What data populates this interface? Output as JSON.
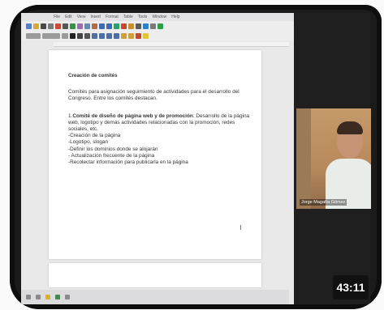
{
  "menu": {
    "items": [
      "File",
      "Edit",
      "View",
      "Insert",
      "Format",
      "Table",
      "Tools",
      "Window",
      "Help"
    ]
  },
  "document": {
    "title": "Creación de comités",
    "intro": "Comités para asignación seguimiento de actividades para el desarrollo del Congreso. Entre los comités destacan.",
    "committee_lead_number": "1.",
    "committee_lead_bold": "Comité de diseño de página web y de promoción",
    "committee_lead_rest": ": Desarrollo de la página web, logotipo y demás actividades relacionadas con la promoción, redes sociales, etc.",
    "tasks": [
      "-Creación de la página",
      "-Logotipo, slogan",
      "-Definir los dominios donde se alojarán",
      "- Actualización frecuente de la página",
      "-Recolectar información para publicarla en la página"
    ]
  },
  "webcam": {
    "name_label": "Jorge Magaña Gómez"
  },
  "video": {
    "timestamp": "43:11"
  },
  "colors": {
    "frame": "#1b1b1b",
    "page": "#ffffff",
    "background": "#e9e9ea",
    "timer_bg": "#111111"
  }
}
